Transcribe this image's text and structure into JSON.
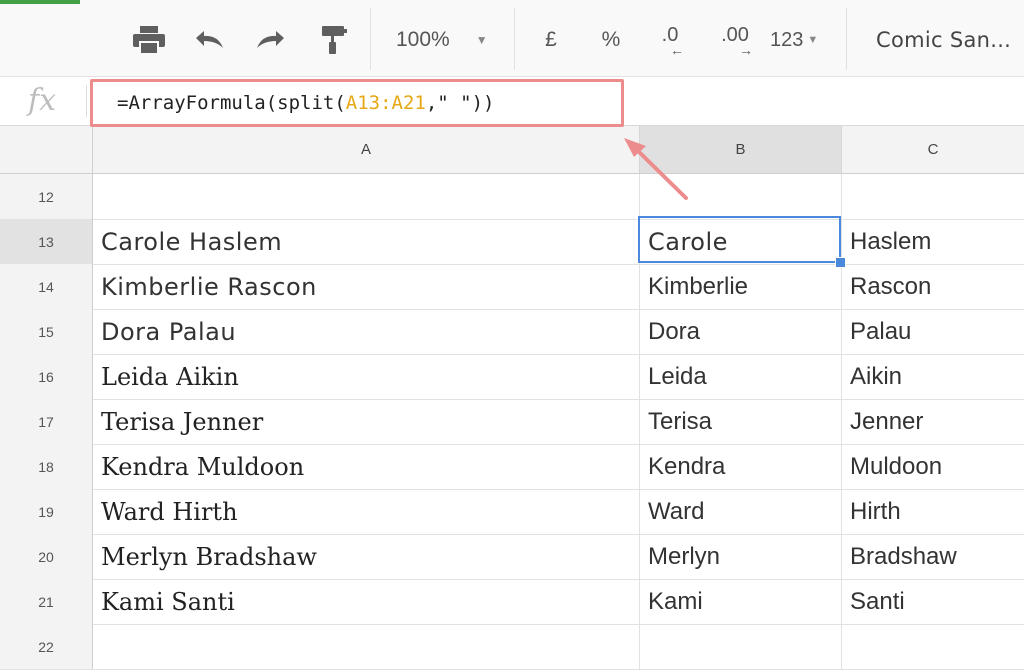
{
  "toolbar": {
    "zoom": "100%",
    "currency": "£",
    "percent": "%",
    "decrease_decimal": ".0",
    "increase_decimal": ".00",
    "more_formats": "123",
    "font": "Comic San..."
  },
  "formula_bar": {
    "fx_label": "fx",
    "prefix": "=ArrayFormula(split(",
    "range": "A13:A21",
    "suffix": ",\" \"))"
  },
  "columns": [
    "A",
    "B",
    "C"
  ],
  "rows": [
    {
      "num": "12",
      "a": "",
      "b": "",
      "c": ""
    },
    {
      "num": "13",
      "a": "Carole Haslem",
      "b": "Carole",
      "c": "Haslem"
    },
    {
      "num": "14",
      "a": "Kimberlie Rascon",
      "b": "Kimberlie",
      "c": "Rascon"
    },
    {
      "num": "15",
      "a": "Dora Palau",
      "b": "Dora",
      "c": "Palau"
    },
    {
      "num": "16",
      "a": "Leida Aikin",
      "b": "Leida",
      "c": "Aikin"
    },
    {
      "num": "17",
      "a": "Terisa Jenner",
      "b": "Terisa",
      "c": "Jenner"
    },
    {
      "num": "18",
      "a": "Kendra Muldoon",
      "b": "Kendra",
      "c": "Muldoon"
    },
    {
      "num": "19",
      "a": "Ward Hirth",
      "b": "Ward",
      "c": "Hirth"
    },
    {
      "num": "20",
      "a": "Merlyn Bradshaw",
      "b": "Merlyn",
      "c": "Bradshaw"
    },
    {
      "num": "21",
      "a": "Kami Santi",
      "b": "Kami",
      "c": "Santi"
    },
    {
      "num": "22",
      "a": "",
      "b": "",
      "c": ""
    }
  ],
  "colors": {
    "highlight_box": "#ec8c8c",
    "range_reference": "#e6a817",
    "active_cell": "#4a89dc"
  }
}
